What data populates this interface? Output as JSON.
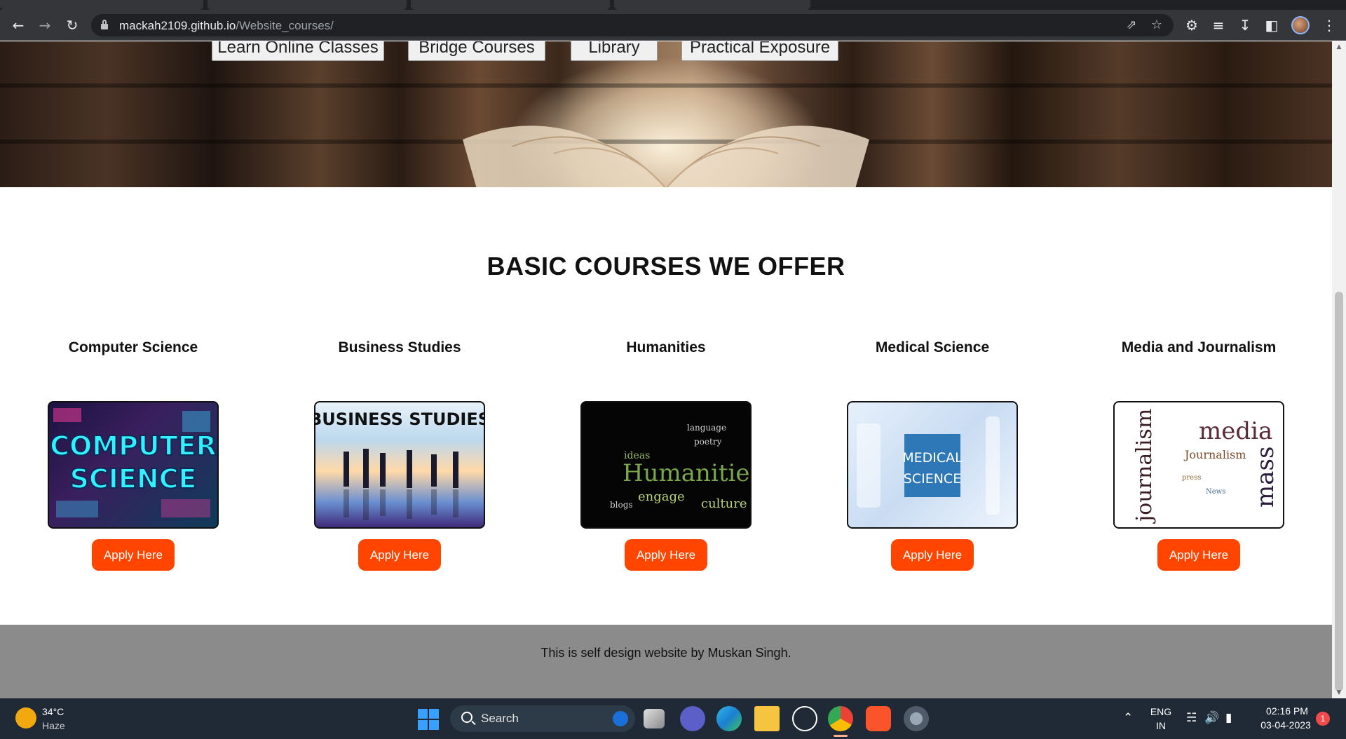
{
  "browser": {
    "url_host": "mackah2109.github.io",
    "url_path": "/Website_courses/",
    "accent_color": "#8ab4f8"
  },
  "nav_buttons": [
    {
      "label": "Learn Online Classes"
    },
    {
      "label": "Bridge Courses"
    },
    {
      "label": "Library"
    },
    {
      "label": "Practical Exposure"
    }
  ],
  "page": {
    "section_title": "BASIC COURSES WE OFFER",
    "courses": [
      {
        "title": "Computer Science",
        "image_text": "COMPUTER SCIENCE",
        "button": "Apply Here"
      },
      {
        "title": "Business Studies",
        "image_text": "BUSINESS STUDIES",
        "button": "Apply Here"
      },
      {
        "title": "Humanities",
        "image_text": "Humanities",
        "button": "Apply Here"
      },
      {
        "title": "Medical Science",
        "image_text": "MEDICAL SCIENCE",
        "button": "Apply Here"
      },
      {
        "title": "Media and Journalism",
        "image_text": "journalism media mass",
        "button": "Apply Here"
      }
    ],
    "button_color": "#ff4500",
    "footer_text": "This is self design website by Muskan Singh."
  },
  "taskbar": {
    "temperature": "34°C",
    "condition": "Haze",
    "search_label": "Search",
    "language_line1": "ENG",
    "language_line2": "IN",
    "time": "02:16 PM",
    "date": "03-04-2023",
    "notification_count": "1"
  }
}
